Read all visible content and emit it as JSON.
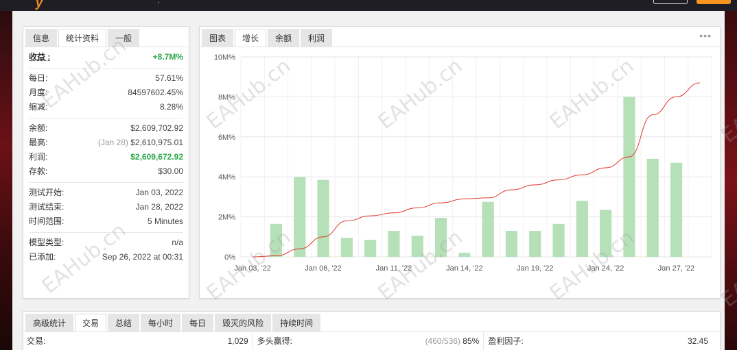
{
  "stats_tabs": [
    "信息",
    "统计资料",
    "一般"
  ],
  "stats": {
    "gain_label": "收益 :",
    "gain_value": "+8.7M%",
    "daily_label": "每日:",
    "daily_value": "57.61%",
    "monthly_label": "月度:",
    "monthly_value": "84597602.45%",
    "drawdown_label": "缩减:",
    "drawdown_value": "8.28%",
    "balance_label": "余额:",
    "balance_value": "$2,609,702.92",
    "highest_label": "最高:",
    "highest_date": "(Jan 28)",
    "highest_value": "$2,610,975.01",
    "profit_label": "利润:",
    "profit_value": "$2,609,672.92",
    "deposits_label": "存款:",
    "deposits_value": "$30.00",
    "test_start_label": "测试开始:",
    "test_start_value": "Jan 03, 2022",
    "test_end_label": "测试结束:",
    "test_end_value": "Jan 28, 2022",
    "timeframe_label": "时间范围:",
    "timeframe_value": "5 Minutes",
    "model_label": "模型类型:",
    "model_value": "n/a",
    "added_label": "已添加:",
    "added_value": "Sep 26, 2022 at 00:31"
  },
  "chart_tabs": [
    "图表",
    "增长",
    "余额",
    "利润"
  ],
  "chart_menu_icon": "more-dots-icon",
  "chart_data": {
    "type": "bar",
    "categories": [
      "Jan 03",
      "Jan 04",
      "Jan 05",
      "Jan 06",
      "Jan 07",
      "Jan 10",
      "Jan 11",
      "Jan 12",
      "Jan 13",
      "Jan 14",
      "Jan 17",
      "Jan 18",
      "Jan 19",
      "Jan 20",
      "Jan 21",
      "Jan 24",
      "Jan 25",
      "Jan 26",
      "Jan 27",
      "Jan 28"
    ],
    "x_tick_labels": [
      "Jan 03, '22",
      "Jan 06, '22",
      "Jan 11, '22",
      "Jan 14, '22",
      "Jan 19, '22",
      "Jan 24, '22",
      "Jan 27, '22"
    ],
    "x_tick_index": [
      0,
      3,
      6,
      9,
      12,
      15,
      18
    ],
    "series": [
      {
        "type": "bar",
        "color": "#b5e0b8",
        "values": [
          0,
          1.65,
          4.0,
          3.85,
          0.95,
          0.85,
          1.3,
          1.05,
          1.95,
          0.2,
          2.75,
          1.3,
          1.3,
          1.65,
          2.8,
          2.35,
          8.0,
          4.9,
          4.7,
          0
        ]
      },
      {
        "type": "line",
        "color": "#e0392b",
        "values": [
          0,
          0.05,
          0.4,
          1.0,
          1.8,
          2.05,
          2.2,
          2.45,
          2.7,
          2.9,
          2.95,
          3.35,
          3.6,
          3.85,
          4.1,
          4.45,
          5.0,
          7.1,
          8.0,
          8.7
        ]
      }
    ],
    "y_tick_labels": [
      "0%",
      "2M%",
      "4M%",
      "6M%",
      "8M%",
      "10M%"
    ],
    "ylim": [
      0,
      10
    ],
    "grid": true
  },
  "bottom_tabs": [
    "高级统计",
    "交易",
    "总结",
    "每小时",
    "每日",
    "毁灭的风险",
    "持续时间"
  ],
  "bottom_row": {
    "trades_label": "交易:",
    "trades_value": "1,029",
    "longs_label": "多头赢得:",
    "longs_count": "(460/536)",
    "longs_value": "85%",
    "pf_label": "盈利因子:",
    "pf_value": "32.45"
  },
  "watermark_text": "EAHub.cn",
  "colors": {
    "accent_green": "#2ba84a",
    "bar_green": "#b5e0b8",
    "line_red": "#e0392b",
    "brand_orange": "#f7931e"
  }
}
